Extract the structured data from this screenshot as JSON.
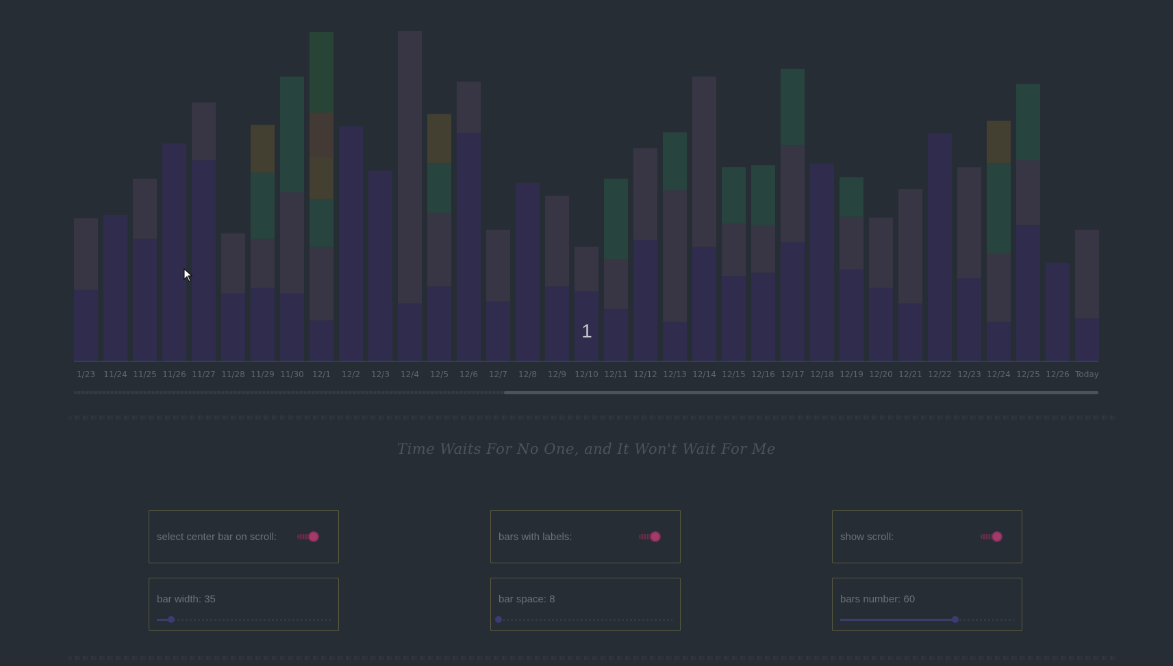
{
  "chart_data": {
    "type": "bar",
    "stacked": true,
    "categories": [
      "1/23",
      "11/24",
      "11/25",
      "11/26",
      "11/27",
      "11/28",
      "11/29",
      "11/30",
      "12/1",
      "12/2",
      "12/3",
      "12/4",
      "12/5",
      "12/6",
      "12/7",
      "12/8",
      "12/9",
      "12/10",
      "12/11",
      "12/12",
      "12/13",
      "12/14",
      "12/15",
      "12/16",
      "12/17",
      "12/18",
      "12/19",
      "12/20",
      "12/21",
      "12/22",
      "12/23",
      "12/24",
      "12/25",
      "12/26",
      "Today"
    ],
    "series": [
      {
        "color": "#2f2c4e",
        "values": [
          105,
          215,
          180,
          320,
          295,
          100,
          108,
          100,
          60,
          345,
          280,
          85,
          110,
          335,
          88,
          262,
          110,
          103,
          77,
          178,
          58,
          168,
          125,
          130,
          175,
          290,
          135,
          108,
          85,
          335,
          122,
          58,
          200,
          145,
          63
        ]
      },
      {
        "color": "#383645",
        "values": [
          105,
          0,
          88,
          0,
          85,
          88,
          72,
          148,
          108,
          0,
          0,
          400,
          108,
          75,
          105,
          0,
          133,
          65,
          73,
          135,
          193,
          250,
          77,
          70,
          142,
          0,
          77,
          103,
          168,
          0,
          163,
          100,
          95,
          0,
          130
        ]
      },
      {
        "color": "#28443f",
        "values": [
          0,
          0,
          0,
          0,
          0,
          0,
          97,
          170,
          70,
          0,
          0,
          0,
          73,
          0,
          0,
          0,
          0,
          0,
          118,
          0,
          85,
          0,
          83,
          88,
          112,
          0,
          58,
          0,
          0,
          0,
          0,
          133,
          112,
          0,
          0
        ]
      },
      {
        "color": "#433f31",
        "values": [
          0,
          0,
          0,
          0,
          0,
          0,
          70,
          0,
          62,
          0,
          0,
          0,
          72,
          0,
          0,
          0,
          0,
          0,
          0,
          0,
          0,
          0,
          0,
          0,
          0,
          0,
          0,
          0,
          0,
          0,
          0,
          62,
          0,
          0,
          0
        ]
      },
      {
        "color": "#433a35",
        "values": [
          0,
          0,
          0,
          0,
          0,
          0,
          0,
          0,
          65,
          0,
          0,
          0,
          0,
          0,
          0,
          0,
          0,
          0,
          0,
          0,
          0,
          0,
          0,
          0,
          0,
          0,
          0,
          0,
          0,
          0,
          0,
          0,
          0,
          0,
          0
        ]
      },
      {
        "color": "#284437",
        "values": [
          0,
          0,
          0,
          0,
          0,
          0,
          0,
          0,
          118,
          0,
          0,
          0,
          0,
          0,
          0,
          0,
          0,
          0,
          0,
          0,
          0,
          0,
          0,
          0,
          0,
          0,
          0,
          0,
          0,
          0,
          0,
          0,
          0,
          0,
          0
        ]
      }
    ],
    "ylim": [
      0,
      490
    ],
    "grid": false,
    "legend": "none"
  },
  "overlay": {
    "selected_count": "1"
  },
  "scroll": {
    "visible_from": 0.42,
    "visible_to": 1.0
  },
  "quote": "Time Waits For No One, and It Won't Wait For Me",
  "controls": {
    "toggles": [
      {
        "label": "select center bar on scroll:",
        "on": true
      },
      {
        "label": "bars with labels:",
        "on": true
      },
      {
        "label": "show scroll:",
        "on": true
      }
    ],
    "sliders": [
      {
        "label": "bar width: 35",
        "value": 35,
        "min": 20,
        "max": 200
      },
      {
        "label": "bar space: 8",
        "value": 8,
        "min": 8,
        "max": 100
      },
      {
        "label": "bars number: 60",
        "value": 60,
        "min": 1,
        "max": 90
      }
    ]
  },
  "colors": {
    "background": "#272d35",
    "axis": "#4a5059",
    "toggle_accent": "#a33a6a",
    "slider_accent": "#3e3a74"
  }
}
